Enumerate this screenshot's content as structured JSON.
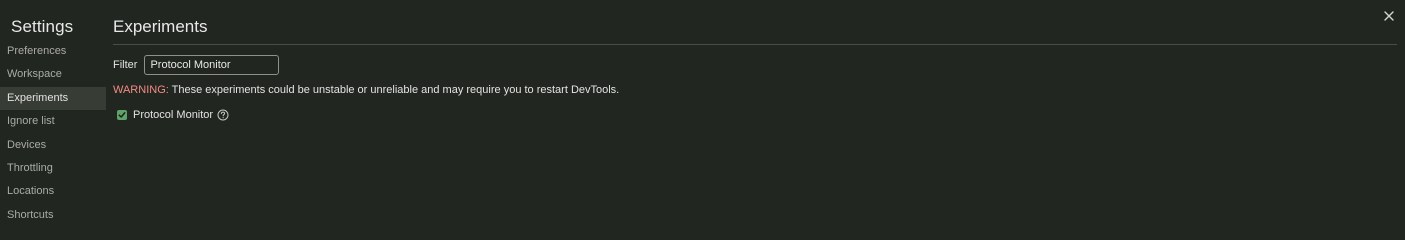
{
  "sidebar": {
    "title": "Settings",
    "items": [
      {
        "label": "Preferences"
      },
      {
        "label": "Workspace"
      },
      {
        "label": "Experiments"
      },
      {
        "label": "Ignore list"
      },
      {
        "label": "Devices"
      },
      {
        "label": "Throttling"
      },
      {
        "label": "Locations"
      },
      {
        "label": "Shortcuts"
      }
    ],
    "selected": "Experiments"
  },
  "main": {
    "title": "Experiments",
    "filter": {
      "label": "Filter",
      "value": "Protocol Monitor"
    },
    "warning": {
      "label": "WARNING:",
      "text": " These experiments could be unstable or unreliable and may require you to restart DevTools."
    },
    "experiments": [
      {
        "label": "Protocol Monitor",
        "checked": true
      }
    ]
  },
  "icons": {
    "close": "close-icon",
    "help": "help-circle-icon",
    "check": "checkmark-icon"
  },
  "colors": {
    "background": "#222621",
    "selected_nav": "#373c35",
    "warning": "#f28b82",
    "checkbox": "#5fa26a"
  }
}
